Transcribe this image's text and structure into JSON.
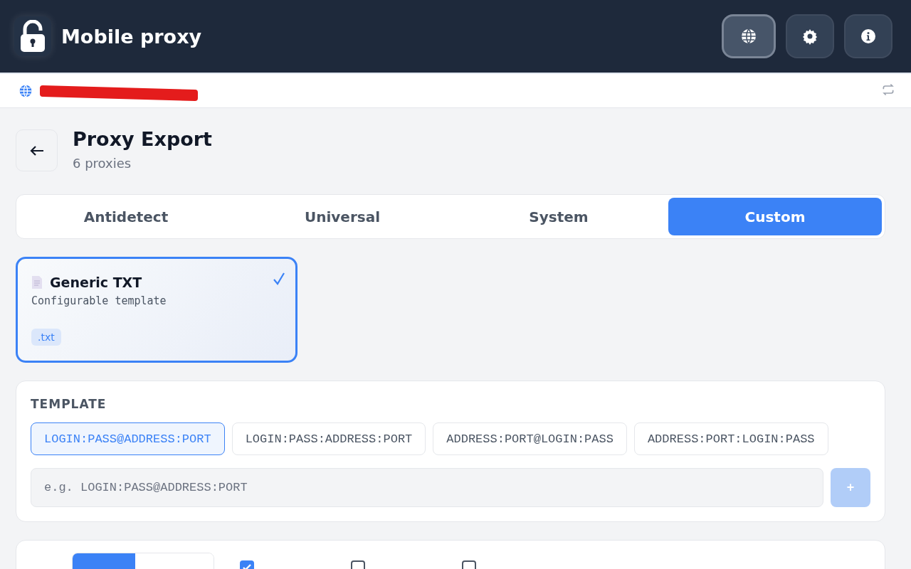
{
  "header": {
    "title": "Mobile proxy",
    "buttons": [
      {
        "kind": "globe",
        "selected": true
      },
      {
        "kind": "gear",
        "selected": false
      },
      {
        "kind": "info",
        "selected": false
      }
    ]
  },
  "address_bar": {
    "redacted": true
  },
  "page": {
    "title": "Proxy Export",
    "subtitle": "6 proxies"
  },
  "tabs": [
    {
      "label": "Antidetect",
      "selected": false
    },
    {
      "label": "Universal",
      "selected": false
    },
    {
      "label": "System",
      "selected": false
    },
    {
      "label": "Custom",
      "selected": true
    }
  ],
  "formats": [
    {
      "title": "Generic TXT",
      "description": "Configurable template",
      "extension": ".txt",
      "selected": true
    }
  ],
  "template": {
    "heading": "TEMPLATE",
    "presets": [
      {
        "label": "LOGIN:PASS@ADDRESS:PORT",
        "selected": true
      },
      {
        "label": "LOGIN:PASS:ADDRESS:PORT",
        "selected": false
      },
      {
        "label": "ADDRESS:PORT@LOGIN:PASS",
        "selected": false
      },
      {
        "label": "ADDRESS:PORT:LOGIN:PASS",
        "selected": false
      }
    ],
    "input": {
      "placeholder": "e.g. LOGIN:PASS@ADDRESS:PORT"
    },
    "add_button": {
      "label": "+",
      "disabled": true
    }
  },
  "options": {
    "types": [
      {
        "selected": true
      },
      {
        "selected": false
      }
    ],
    "checkboxes": [
      {
        "checked": true
      },
      {
        "checked": false
      },
      {
        "checked": false
      }
    ]
  }
}
